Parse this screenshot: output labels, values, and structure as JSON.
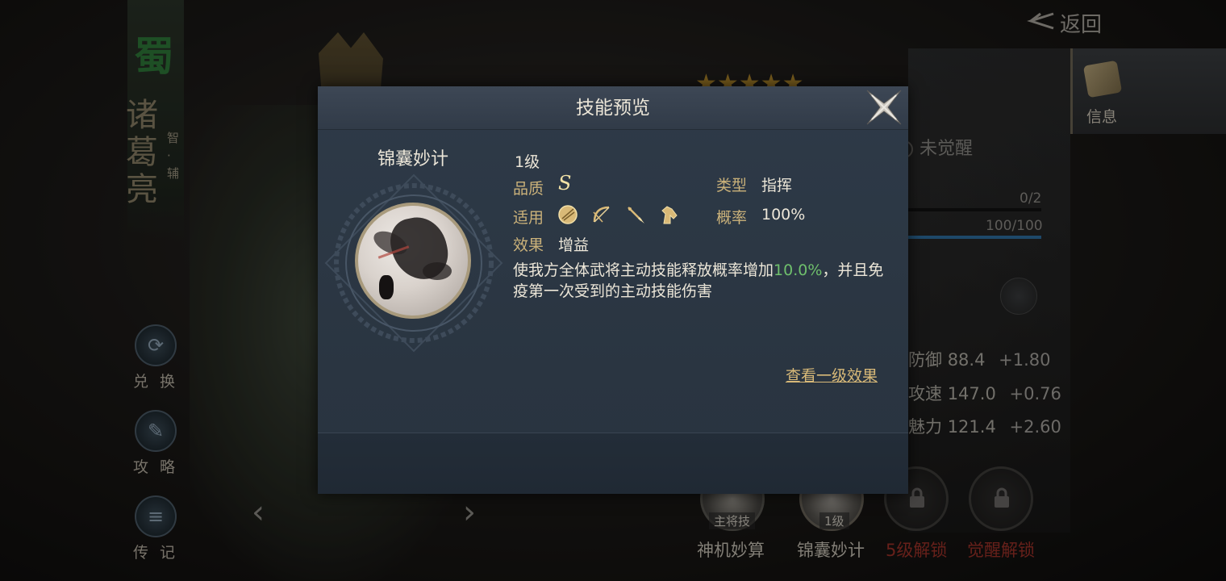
{
  "background": {
    "faction": "蜀",
    "hero_name": "诸葛亮",
    "hero_role": "智·辅",
    "side_buttons": [
      "兑 换",
      "攻 略",
      "传 记"
    ],
    "nav_prev": "‹",
    "nav_next": "›"
  },
  "right_panel": {
    "back_label": "返回",
    "info_tab_label": "信息",
    "stars": "★★★★★",
    "awaken_status": "未觉醒",
    "progress_1": "0/2",
    "progress_2": "100/100",
    "stats": [
      {
        "name": "防御",
        "value": "88.4",
        "bonus": "+1.80"
      },
      {
        "name": "攻速",
        "value": "147.0",
        "bonus": "+0.76"
      },
      {
        "name": "魅力",
        "value": "121.4",
        "bonus": "+2.60"
      }
    ]
  },
  "skill_strip": {
    "main_tag": "主将技",
    "active_tag": "1级",
    "names": [
      "神机妙算",
      "锦囊妙计",
      "5级解锁",
      "觉醒解锁"
    ]
  },
  "modal": {
    "title": "技能预览",
    "skill_name": "锦囊妙计",
    "level": "1级",
    "quality_label": "品质",
    "quality_value": "S",
    "type_label": "类型",
    "type_value": "指挥",
    "applicable_label": "适用",
    "applicable_units": [
      "shield-unit-icon",
      "bow-unit-icon",
      "spear-unit-icon",
      "cavalry-unit-icon"
    ],
    "probability_label": "概率",
    "probability_value": "100%",
    "effect_label": "效果",
    "effect_value": "增益",
    "desc_prefix": "使我方全体武将主动技能释放概率增加",
    "desc_highlight": "10.0%",
    "desc_suffix": "，并且免疫第一次受到的主动技能伤害",
    "view_level_one": "查看一级效果"
  },
  "colors": {
    "accent_gold": "#cbb27a",
    "highlight_green": "#6fbf6c",
    "locked_red": "#9e3229"
  }
}
